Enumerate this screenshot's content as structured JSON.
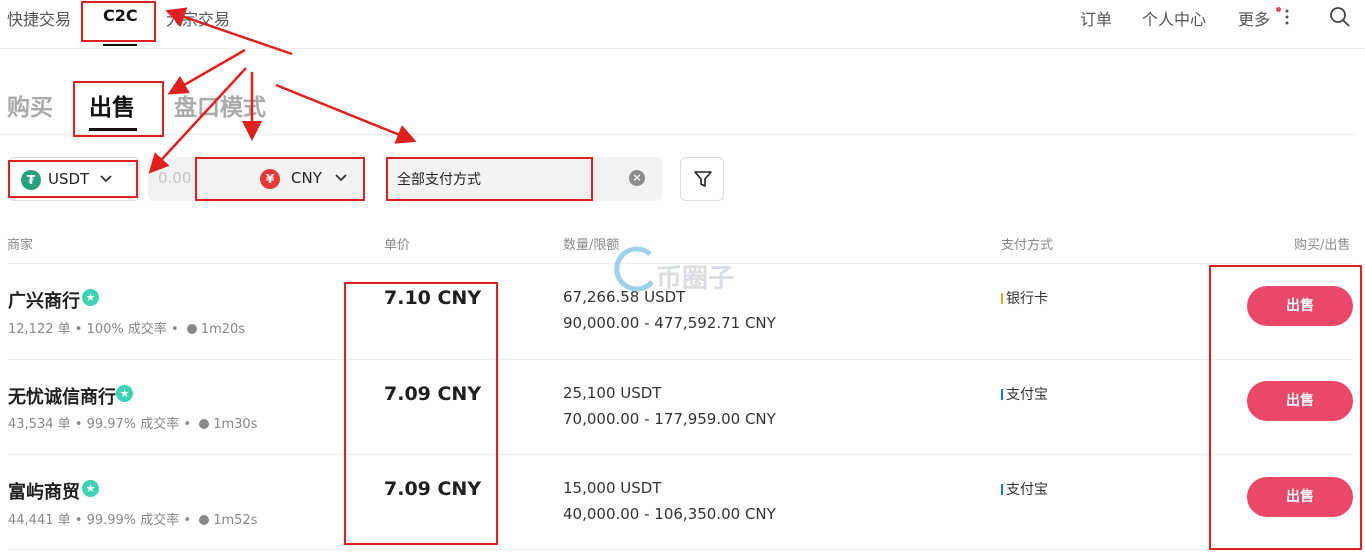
{
  "topnav": {
    "left_items": [
      "快捷交易",
      "C2C",
      "大宗交易"
    ],
    "right_items": [
      "订单",
      "个人中心",
      "更多"
    ]
  },
  "tabs": [
    "购买",
    "出售",
    "盘口模式"
  ],
  "filters": {
    "coin": "USDT",
    "amount_placeholder": "0.00",
    "fiat": "CNY",
    "fiat_symbol": "¥",
    "payment": "全部支付方式"
  },
  "table": {
    "headers": [
      "商家",
      "单价",
      "数量/限额",
      "支付方式",
      "购买/出售"
    ],
    "rows": [
      {
        "merchant": "广兴商行",
        "orders": "12,122 单",
        "rate": "100% 成交率",
        "time": "1m20s",
        "price": "7.10 CNY",
        "quantity": "67,266.58 USDT",
        "limit": "90,000.00 - 477,592.71 CNY",
        "payment": "银行卡",
        "payment_color": "#f0a030",
        "action": "出售"
      },
      {
        "merchant": "无忧诚信商行",
        "orders": "43,534 单",
        "rate": "99.97% 成交率",
        "time": "1m30s",
        "price": "7.09 CNY",
        "quantity": "25,100 USDT",
        "limit": "70,000.00 - 177,959.00 CNY",
        "payment": "支付宝",
        "payment_color": "#1677ff",
        "action": "出售"
      },
      {
        "merchant": "富屿商贸",
        "orders": "44,441 单",
        "rate": "99.99% 成交率",
        "time": "1m52s",
        "price": "7.09 CNY",
        "quantity": "15,000 USDT",
        "limit": "40,000.00 - 106,350.00 CNY",
        "payment": "支付宝",
        "payment_color": "#1677ff",
        "action": "出售"
      }
    ]
  },
  "watermark": "币圈子",
  "colors": {
    "accent": "#e9486a",
    "annotation": "#e02020",
    "verified": "#3dd3b0"
  }
}
